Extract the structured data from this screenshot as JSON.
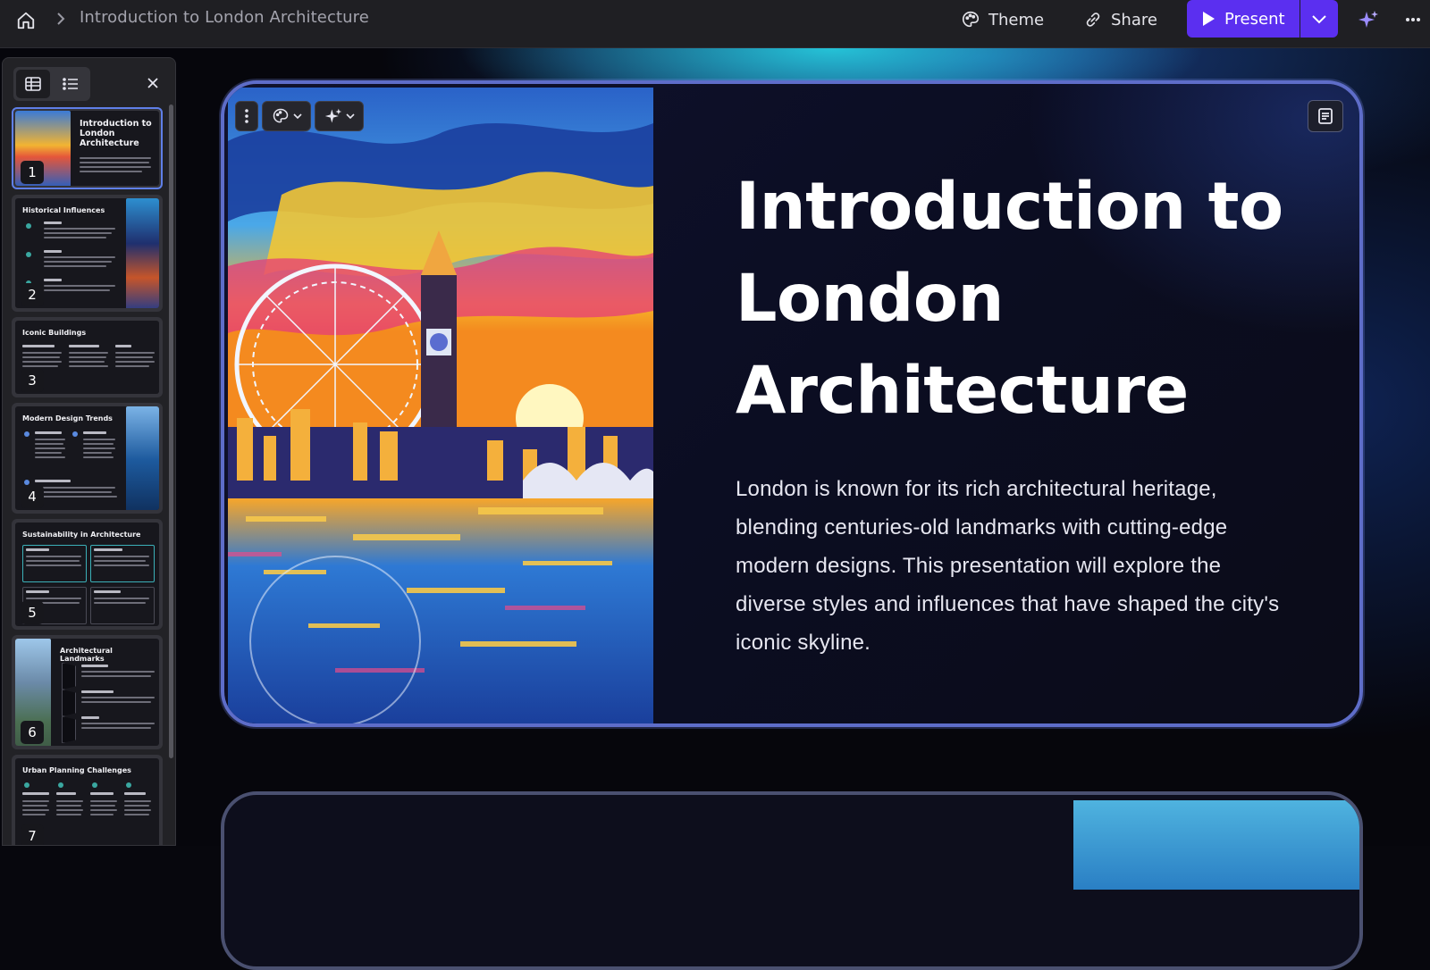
{
  "header": {
    "breadcrumb_title": "Introduction to London Architecture",
    "theme_label": "Theme",
    "share_label": "Share",
    "present_label": "Present"
  },
  "sidebar": {
    "thumbnails": [
      {
        "number": "1",
        "title": "Introduction to London Architecture",
        "selected": true
      },
      {
        "number": "2",
        "title": "Historical Influences",
        "items": [
          "Medieval",
          "Georgian",
          "Victorian"
        ]
      },
      {
        "number": "3",
        "title": "Iconic Buildings",
        "columns": [
          "Houses of Parliament",
          "St. Paul's Cathedral",
          "The Shard"
        ]
      },
      {
        "number": "4",
        "title": "Modern Design Trends",
        "items": [
          "Sustainable Design",
          "Innovative Structures",
          "Mixed-Use Developments"
        ]
      },
      {
        "number": "5",
        "title": "Sustainability in Architecture",
        "boxes": [
          "Green Buildings",
          "Urban Greenspaces",
          "Adaptive Reuse",
          "Circular Economy"
        ]
      },
      {
        "number": "6",
        "title": "Architectural Landmarks",
        "items": [
          "Tower of London",
          "Buckingham Palace",
          "The Shard"
        ],
        "steps": [
          "1",
          "2",
          "3"
        ]
      },
      {
        "number": "7",
        "title": "Urban Planning Challenges",
        "columns": [
          "Transportation",
          "Affordable Housing",
          "Green Spaces",
          "Heritage Preservation"
        ]
      }
    ]
  },
  "slide": {
    "title": "Introduction to London Architecture",
    "body": "London is known for its rich architectural heritage, blending centuries-old landmarks with cutting-edge modern designs. This presentation will explore the diverse styles and influences that have shaped the city's iconic skyline."
  },
  "colors": {
    "accent": "#5b2ff0",
    "selection_border": "#5f7fe8",
    "slide_border": "#5e6dc9",
    "glow": "#28dceb"
  },
  "icons": [
    "home-icon",
    "chevron-right-icon",
    "palette-icon",
    "link-icon",
    "play-icon",
    "chevron-down-icon",
    "sparkle-icon",
    "more-icon",
    "grid-view-icon",
    "list-view-icon",
    "close-icon",
    "kebab-icon",
    "notes-icon"
  ]
}
